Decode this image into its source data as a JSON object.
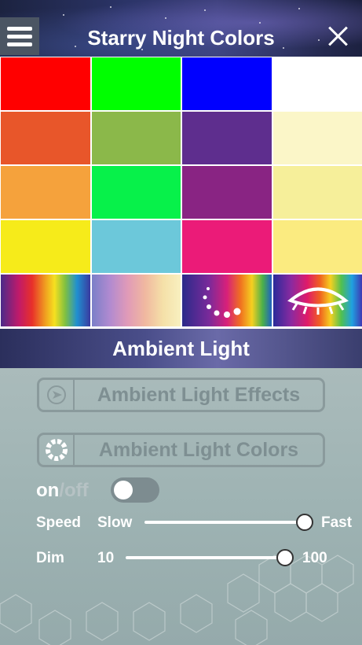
{
  "header": {
    "title": "Starry Night Colors"
  },
  "colors": [
    {
      "name": "red",
      "color": "#ff0000"
    },
    {
      "name": "green",
      "color": "#00ff00"
    },
    {
      "name": "blue",
      "color": "#0000ff"
    },
    {
      "name": "white",
      "color": "#ffffff"
    },
    {
      "name": "orange-red",
      "color": "#e8562a"
    },
    {
      "name": "olive-green",
      "color": "#8bb84a"
    },
    {
      "name": "purple",
      "color": "#5e2e8e"
    },
    {
      "name": "cream",
      "color": "#fbf6c8"
    },
    {
      "name": "orange",
      "color": "#f5a23c"
    },
    {
      "name": "bright-green",
      "color": "#07f14a"
    },
    {
      "name": "violet",
      "color": "#892483"
    },
    {
      "name": "pale-yellow",
      "color": "#f6ef9a"
    },
    {
      "name": "yellow",
      "color": "#f6eb1a"
    },
    {
      "name": "sky-blue",
      "color": "#6cc8da"
    },
    {
      "name": "magenta",
      "color": "#eb1b78"
    },
    {
      "name": "light-yellow",
      "color": "#fbeb80"
    }
  ],
  "effects": [
    {
      "name": "spectrum-effect",
      "icon": "none"
    },
    {
      "name": "pastel-spectrum-effect",
      "icon": "none"
    },
    {
      "name": "dots-spectrum-effect",
      "icon": "dots-circle-icon"
    },
    {
      "name": "eye-spectrum-effect",
      "icon": "eye-icon"
    }
  ],
  "ambient": {
    "title": "Ambient Light",
    "effects_label": "Ambient Light Effects",
    "effects_icon": "play-arrow-icon",
    "colors_label": "Ambient Light Colors",
    "colors_icon": "color-wheel-icon",
    "on_label": "on",
    "off_label": "/off",
    "toggle_on": false,
    "speed": {
      "label": "Speed",
      "min_label": "Slow",
      "max_label": "Fast",
      "value": 1.0
    },
    "dim": {
      "label": "Dim",
      "min_label": "10",
      "max_label": "100",
      "value": 1.0
    }
  }
}
